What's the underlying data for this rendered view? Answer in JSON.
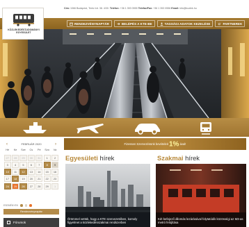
{
  "contact": {
    "address_label": "Cím:",
    "address": "1066 Budapest, Teréz krt. 38. 4/30.",
    "phone_label": "Telefon:",
    "phone": "+36 1 353 0555",
    "fax_label": "Telefax/Fax:",
    "fax": "+36 1 353 0556",
    "email_label": "Email:",
    "email": "info@kozlek.hu"
  },
  "logo": {
    "line1": "KÖZLEKEDÉSTUDOMÁNYI",
    "line2": "EGYESÜLET",
    "icon": "tram-logo"
  },
  "nav": {
    "items": [
      {
        "label": "RENDEZVÉNYNAPTÁR",
        "icon": "calendar-icon"
      },
      {
        "label": "BELÉPÉS A KTE-BE",
        "icon": "login-icon"
      },
      {
        "label": "TAGSÁGI ADATOK KEZELÉSE",
        "icon": "user-icon"
      },
      {
        "label": "PARTNEREK",
        "icon": "handshake-icon"
      }
    ]
  },
  "categories": [
    {
      "name": "ship",
      "icon": "ship-icon"
    },
    {
      "name": "plane",
      "icon": "plane-icon"
    },
    {
      "name": "car",
      "icon": "car-icon"
    },
    {
      "name": "tram",
      "icon": "tram-icon"
    }
  ],
  "calendar": {
    "month": "FEBRUÁR 2020",
    "weekdays": [
      "Hé",
      "Ke",
      "Sze",
      "Cs",
      "Pé",
      "Szo",
      "Va"
    ],
    "weeks": [
      [
        "27",
        "28",
        "29",
        "30",
        "31",
        "1",
        "2"
      ],
      [
        "3",
        "4",
        "5",
        "6",
        "7",
        "8",
        "9"
      ],
      [
        "10",
        "11",
        "12",
        "13",
        "14",
        "15",
        "16"
      ],
      [
        "17",
        "18",
        "19",
        "20",
        "21",
        "22",
        "23"
      ],
      [
        "24",
        "25",
        "26",
        "27",
        "28",
        "29",
        "1"
      ]
    ],
    "legend": "ESEMÉNYEK",
    "button": "Rendezvénynaptár"
  },
  "forum_button": "Fórumok",
  "discount": {
    "prefix": "Fizessen Szervezésünk bevételeit",
    "percent": "1%",
    "suffix": "ával!"
  },
  "sections": [
    {
      "accent": "Egyesületi",
      "rest": "hírek",
      "caption": "Örömmel vettük, hogy a KTE szervezetében, komoly figyelmet a közlekedésszakmai rendszerben"
    },
    {
      "accent": "Szakmai",
      "rest": "hírek",
      "caption": "Két befejező állomás lezárásával folytatódik közösségi az M3-as metró felújítása"
    }
  ],
  "colors": {
    "brand_gold": "#a57a30",
    "nav_dark": "#8c6420",
    "accent_orange": "#e8732c",
    "dark_button": "#3d3d3d"
  }
}
